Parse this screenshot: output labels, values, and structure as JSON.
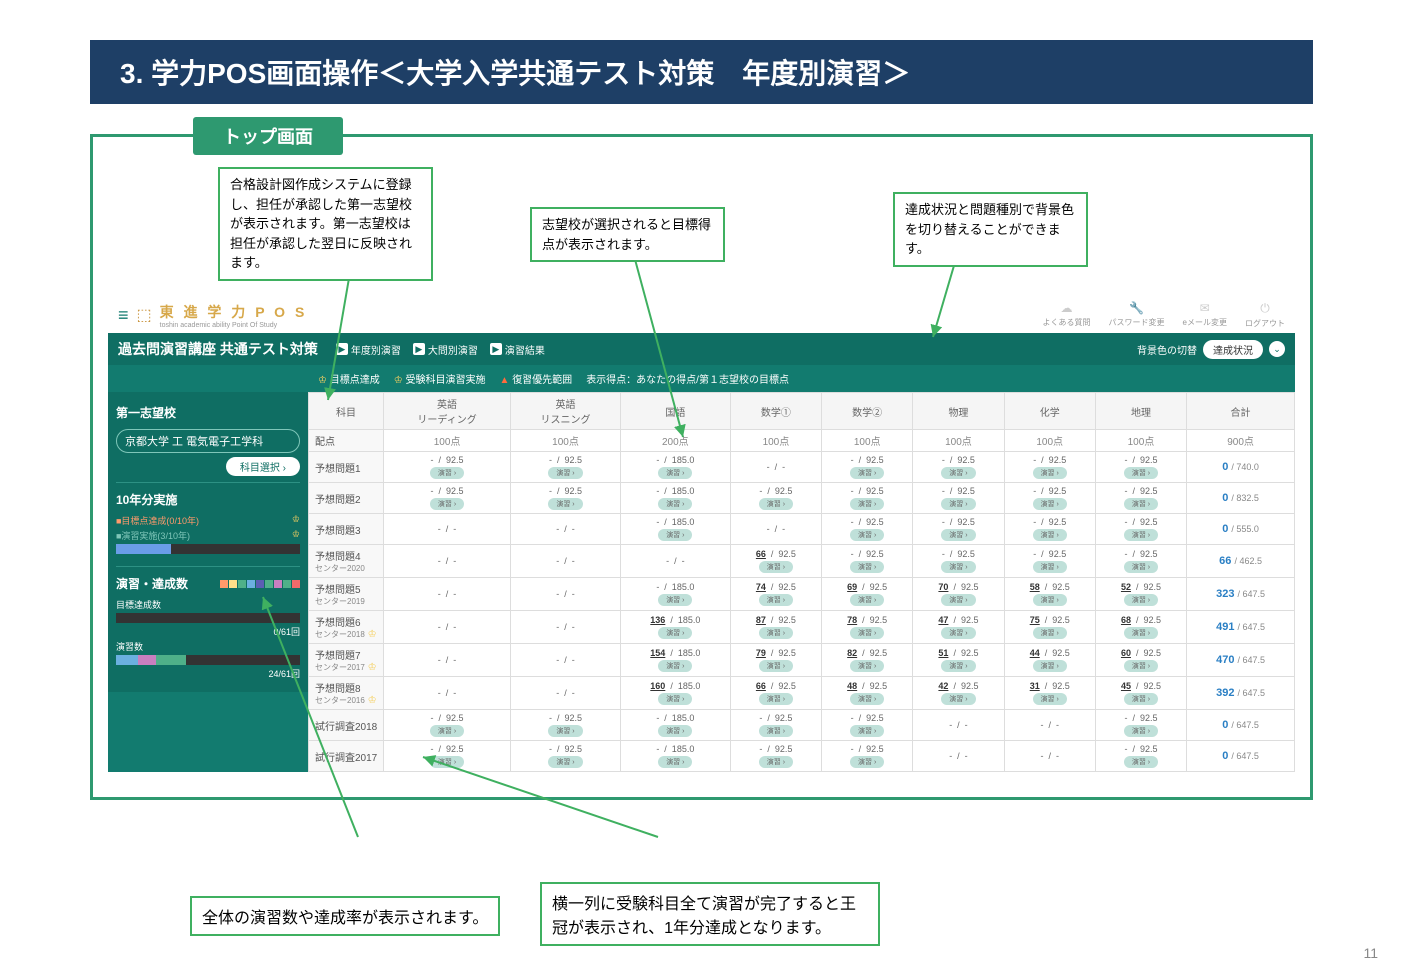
{
  "page_title": "3. 学力POS画面操作＜大学入学共通テスト対策　年度別演習＞",
  "top_label": "トップ画面",
  "callouts": {
    "c1": "合格設計図作成システムに登録し、担任が承認した第一志望校が表示されます。第一志望校は担任が承認した翌日に反映されます。",
    "c2": "志望校が選択されると目標得点が表示されます。",
    "c3": "達成状況と問題種別で背景色を切り替えることができます。",
    "c4": "全体の演習数や達成率が表示されます。",
    "c5": "横一列に受験科目全て演習が完了すると王冠が表示され、1年分達成となります。"
  },
  "app": {
    "logo": "東 進 学 力  P  O  S",
    "logo_sub": "toshin academic ability Point Of Study",
    "header_icons": [
      "よくある質問",
      "パスワード変更",
      "eメール変更",
      "ログアウト"
    ],
    "breadcrumb": "過去問演習講座 共通テスト対策",
    "tabs": [
      "年度別演習",
      "大問別演習",
      "演習結果"
    ],
    "bg_label": "背景色の切替",
    "bg_value": "達成状況",
    "legend": [
      "目標点達成",
      "受験科目演習実施",
      "復習優先範囲",
      "表示得点：あなたの得点/第１志望校の目標点"
    ]
  },
  "sidebar": {
    "sec1": "第一志望校",
    "school": "京都大学 工 電気電子工学科",
    "subject_select": "科目選択",
    "sec2": "10年分実施",
    "goal_line": "■目標点達成(0/10年)",
    "practice_line": "■演習実施(3/10年)",
    "sec3": "演習・達成数",
    "goal_count_label": "目標達成数",
    "goal_count_value": "0/61回",
    "practice_count_label": "演習数",
    "practice_count_value": "24/61回"
  },
  "table": {
    "headers": [
      "科目",
      "英語\nリーディング",
      "英語\nリスニング",
      "国語",
      "数学①",
      "数学②",
      "物理",
      "化学",
      "地理",
      "合計"
    ],
    "haiten_label": "配点",
    "haiten": [
      "100点",
      "100点",
      "200点",
      "100点",
      "100点",
      "100点",
      "100点",
      "100点",
      "900点"
    ],
    "rows": [
      {
        "name": "予想問題1",
        "sub": "",
        "crown": false,
        "cells": [
          [
            "-",
            "92.5"
          ],
          [
            "-",
            "92.5"
          ],
          [
            "-",
            "185.0"
          ],
          [
            "-",
            "-"
          ],
          [
            "-",
            "92.5"
          ],
          [
            "-",
            "92.5"
          ],
          [
            "-",
            "92.5"
          ],
          [
            "-",
            "92.5"
          ]
        ],
        "total": [
          "0",
          "740.0"
        ]
      },
      {
        "name": "予想問題2",
        "sub": "",
        "crown": false,
        "cells": [
          [
            "-",
            "92.5"
          ],
          [
            "-",
            "92.5"
          ],
          [
            "-",
            "185.0"
          ],
          [
            "-",
            "92.5"
          ],
          [
            "-",
            "92.5"
          ],
          [
            "-",
            "92.5"
          ],
          [
            "-",
            "92.5"
          ],
          [
            "-",
            "92.5"
          ]
        ],
        "total": [
          "0",
          "832.5"
        ]
      },
      {
        "name": "予想問題3",
        "sub": "",
        "crown": false,
        "cells": [
          [
            "-",
            "-"
          ],
          [
            "-",
            "-"
          ],
          [
            "-",
            "185.0"
          ],
          [
            "-",
            "-"
          ],
          [
            "-",
            "92.5"
          ],
          [
            "-",
            "92.5"
          ],
          [
            "-",
            "92.5"
          ],
          [
            "-",
            "92.5"
          ]
        ],
        "total": [
          "0",
          "555.0"
        ]
      },
      {
        "name": "予想問題4",
        "sub": "センター2020",
        "crown": false,
        "cells": [
          [
            "-",
            "-"
          ],
          [
            "-",
            "-"
          ],
          [
            "-",
            "-"
          ],
          [
            "66",
            "92.5"
          ],
          [
            "-",
            "92.5"
          ],
          [
            "-",
            "92.5"
          ],
          [
            "-",
            "92.5"
          ],
          [
            "-",
            "92.5"
          ]
        ],
        "total": [
          "66",
          "462.5"
        ]
      },
      {
        "name": "予想問題5",
        "sub": "センター2019",
        "crown": false,
        "cells": [
          [
            "-",
            "-"
          ],
          [
            "-",
            "-"
          ],
          [
            "-",
            "185.0"
          ],
          [
            "74",
            "92.5"
          ],
          [
            "69",
            "92.5"
          ],
          [
            "70",
            "92.5"
          ],
          [
            "58",
            "92.5"
          ],
          [
            "52",
            "92.5"
          ]
        ],
        "total": [
          "323",
          "647.5"
        ]
      },
      {
        "name": "予想問題6",
        "sub": "センター2018",
        "crown": true,
        "cells": [
          [
            "-",
            "-"
          ],
          [
            "-",
            "-"
          ],
          [
            "136",
            "185.0"
          ],
          [
            "87",
            "92.5"
          ],
          [
            "78",
            "92.5"
          ],
          [
            "47",
            "92.5"
          ],
          [
            "75",
            "92.5"
          ],
          [
            "68",
            "92.5"
          ]
        ],
        "total": [
          "491",
          "647.5"
        ]
      },
      {
        "name": "予想問題7",
        "sub": "センター2017",
        "crown": true,
        "cells": [
          [
            "-",
            "-"
          ],
          [
            "-",
            "-"
          ],
          [
            "154",
            "185.0"
          ],
          [
            "79",
            "92.5"
          ],
          [
            "82",
            "92.5"
          ],
          [
            "51",
            "92.5"
          ],
          [
            "44",
            "92.5"
          ],
          [
            "60",
            "92.5"
          ]
        ],
        "total": [
          "470",
          "647.5"
        ]
      },
      {
        "name": "予想問題8",
        "sub": "センター2016",
        "crown": true,
        "cells": [
          [
            "-",
            "-"
          ],
          [
            "-",
            "-"
          ],
          [
            "160",
            "185.0"
          ],
          [
            "66",
            "92.5"
          ],
          [
            "48",
            "92.5"
          ],
          [
            "42",
            "92.5"
          ],
          [
            "31",
            "92.5"
          ],
          [
            "45",
            "92.5"
          ]
        ],
        "total": [
          "392",
          "647.5"
        ]
      },
      {
        "name": "試行調査2018",
        "sub": "",
        "crown": false,
        "cells": [
          [
            "-",
            "92.5"
          ],
          [
            "-",
            "92.5"
          ],
          [
            "-",
            "185.0"
          ],
          [
            "-",
            "92.5"
          ],
          [
            "-",
            "92.5"
          ],
          [
            "-",
            "-"
          ],
          [
            "-",
            "-"
          ],
          [
            "-",
            "92.5"
          ]
        ],
        "total": [
          "0",
          "647.5"
        ]
      },
      {
        "name": "試行調査2017",
        "sub": "",
        "crown": false,
        "cells": [
          [
            "-",
            "92.5"
          ],
          [
            "-",
            "92.5"
          ],
          [
            "-",
            "185.0"
          ],
          [
            "-",
            "92.5"
          ],
          [
            "-",
            "92.5"
          ],
          [
            "-",
            "-"
          ],
          [
            "-",
            "-"
          ],
          [
            "-",
            "92.5"
          ]
        ],
        "total": [
          "0",
          "647.5"
        ]
      }
    ]
  },
  "page_num": "11"
}
